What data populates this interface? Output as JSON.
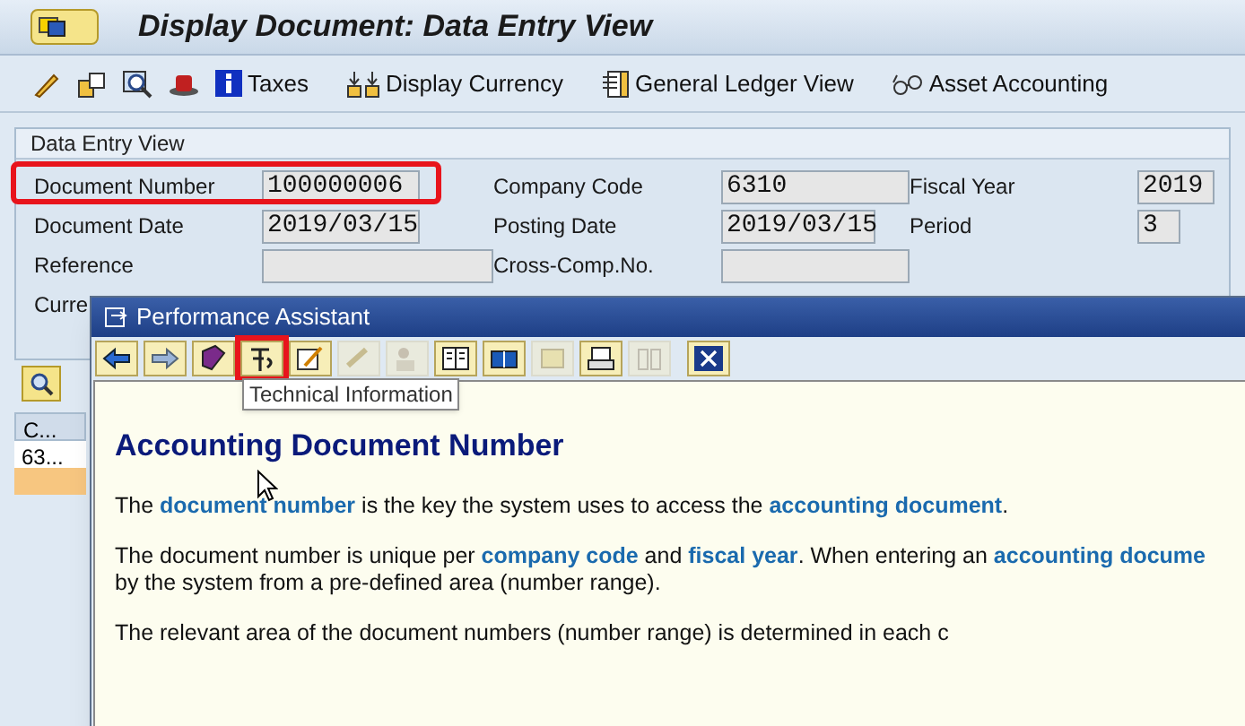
{
  "window": {
    "title": "Display Document: Data Entry View"
  },
  "toolbar": [
    {
      "kind": "icon"
    },
    {
      "kind": "icon"
    },
    {
      "kind": "icon"
    },
    {
      "kind": "icon"
    },
    {
      "label": "Taxes"
    },
    {
      "label": "Display Currency"
    },
    {
      "label": "General Ledger View"
    },
    {
      "label": "Asset Accounting"
    }
  ],
  "group": {
    "title": "Data Entry View",
    "rows": [
      [
        {
          "label": "Document Number",
          "value": "100000006",
          "highlighted": true
        },
        {
          "label": "Company Code",
          "value": "6310"
        },
        {
          "label": "Fiscal Year",
          "value": "2019"
        }
      ],
      [
        {
          "label": "Document Date",
          "value": "2019/03/15"
        },
        {
          "label": "Posting Date",
          "value": "2019/03/15"
        },
        {
          "label": "Period",
          "value": "3"
        }
      ],
      [
        {
          "label": "Reference",
          "kind": "field"
        },
        {
          "label": "Cross-Comp.No.",
          "kind": "field"
        }
      ],
      [
        {
          "label": "Curre"
        }
      ]
    ]
  },
  "background_table": {
    "header": "C...",
    "rows": [
      {
        "text": "63...",
        "selected": false
      },
      {
        "text": "",
        "selected": true
      }
    ]
  },
  "assistant": {
    "title": "Performance Assistant",
    "buttons": [
      {
        "disabled": false
      },
      {
        "disabled": false
      },
      {
        "disabled": false
      },
      {
        "disabled": false,
        "highlighted": true
      },
      {
        "disabled": false
      },
      {
        "disabled": true
      },
      {
        "disabled": true
      },
      {
        "disabled": false
      },
      {
        "disabled": false
      },
      {
        "disabled": true
      },
      {
        "disabled": false
      },
      {
        "disabled": true
      },
      {
        "disabled": false
      }
    ],
    "tooltip": "Technical Information",
    "heading": "Accounting Document Number",
    "paragraphs": [
      [
        [
          {
            "text": "The "
          },
          {
            "text": "document number",
            "link": true
          },
          {
            "text": " is the key the system uses to access the "
          },
          {
            "text": "accounting document",
            "link": true
          },
          {
            "text": "."
          }
        ]
      ],
      [
        [
          {
            "text": "The document number is unique per "
          },
          {
            "text": "company code",
            "link": true
          },
          {
            "text": " and "
          },
          {
            "text": "fiscal year",
            "link": true
          },
          {
            "text": ". When entering an "
          },
          {
            "text": "accounting docume",
            "link": true
          }
        ],
        [
          {
            "text": "by the system from a pre-defined area (number range)."
          }
        ]
      ],
      [
        [
          {
            "text": "The relevant area of the document numbers (number range) is determined in each c"
          }
        ]
      ]
    ]
  }
}
